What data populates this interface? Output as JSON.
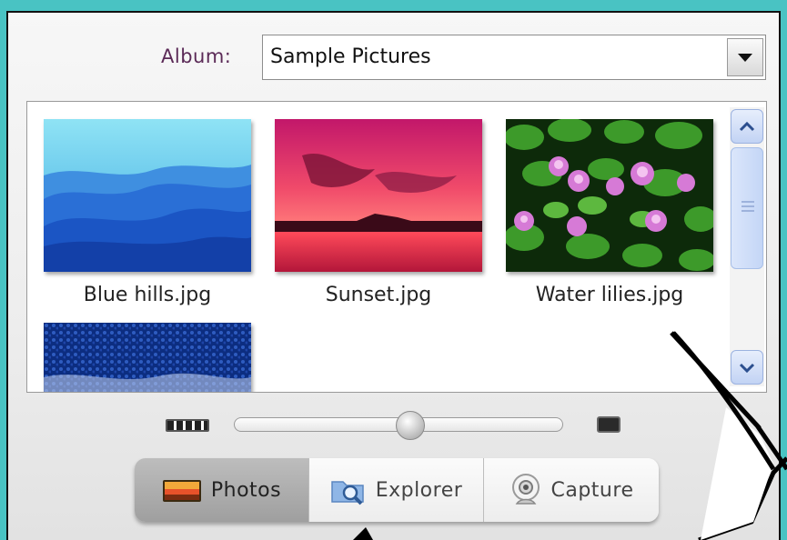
{
  "album": {
    "label": "Album:",
    "selected": "Sample Pictures"
  },
  "thumbnails": [
    {
      "caption": "Blue hills.jpg",
      "icon": "blue-hills-image"
    },
    {
      "caption": "Sunset.jpg",
      "icon": "sunset-image"
    },
    {
      "caption": "Water lilies.jpg",
      "icon": "water-lilies-image"
    },
    {
      "caption": "",
      "icon": "winter-image"
    }
  ],
  "zoom": {
    "level": 0.54
  },
  "tabs": [
    {
      "label": "Photos",
      "icon": "photos-icon",
      "active": true
    },
    {
      "label": "Explorer",
      "icon": "explorer-icon",
      "active": false
    },
    {
      "label": "Capture",
      "icon": "webcam-icon",
      "active": false
    }
  ],
  "colors": {
    "background": "#49c3c3",
    "album_label": "#5b2a57",
    "scrollbar": "#c2d3f4"
  }
}
